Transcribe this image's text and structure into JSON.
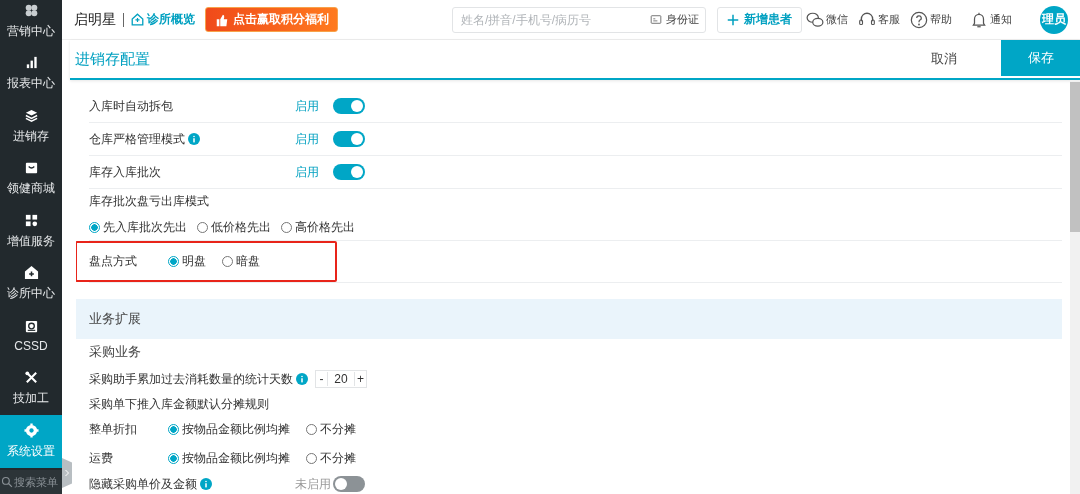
{
  "sidebar": {
    "items": [
      {
        "label": "营销中心",
        "selected": false
      },
      {
        "label": "报表中心",
        "selected": false
      },
      {
        "label": "进销存",
        "selected": false
      },
      {
        "label": "领健商城",
        "selected": false
      },
      {
        "label": "增值服务",
        "selected": false
      },
      {
        "label": "诊所中心",
        "selected": false
      },
      {
        "label": "CSSD",
        "selected": false
      },
      {
        "label": "技加工",
        "selected": false
      },
      {
        "label": "系统设置",
        "selected": true
      }
    ],
    "search_placeholder": "搜索菜单"
  },
  "topbar": {
    "brand": "启明星",
    "overview_link": "诊所概览",
    "promo_banner": "点击赢取积分福利",
    "search_placeholder": "姓名/拼音/手机号/病历号",
    "id_card_button": "身份证",
    "new_patient_button": "新增患者",
    "actions": [
      {
        "label": "微信"
      },
      {
        "label": "客服"
      },
      {
        "label": "帮助"
      },
      {
        "label": "通知"
      }
    ],
    "avatar": "理员"
  },
  "header": {
    "title": "进销存配置",
    "cancel_button": "取消",
    "save_button": "保存"
  },
  "settings": [
    {
      "kind": "toggle",
      "label": "入库时自动拆包",
      "status": "启用",
      "on": true
    },
    {
      "kind": "toggle",
      "label": "仓库严格管理模式",
      "info": true,
      "status": "启用",
      "on": true
    },
    {
      "kind": "toggle",
      "label": "库存入库批次",
      "status": "启用",
      "on": true
    },
    {
      "kind": "radio_stacked",
      "label": "库存批次盘亏出库模式",
      "options": [
        {
          "label": "先入库批次先出",
          "selected": true
        },
        {
          "label": "低价格先出",
          "selected": false
        },
        {
          "label": "高价格先出",
          "selected": false
        }
      ]
    },
    {
      "kind": "radio_inline",
      "label": "盘点方式",
      "highlighted": true,
      "options": [
        {
          "label": "明盘",
          "selected": true
        },
        {
          "label": "暗盘",
          "selected": false
        }
      ]
    },
    {
      "kind": "section",
      "label": "业务扩展"
    },
    {
      "kind": "subheading",
      "label": "采购业务"
    },
    {
      "kind": "stepper",
      "label": "采购助手累加过去消耗数量的统计天数",
      "info": true,
      "minus": "-",
      "value": "20",
      "plus": "+"
    },
    {
      "kind": "text",
      "label": "采购单下推入库金额默认分摊规则"
    },
    {
      "kind": "radio_inline",
      "label": "整单折扣",
      "options": [
        {
          "label": "按物品金额比例均摊",
          "selected": true
        },
        {
          "label": "不分摊",
          "selected": false
        }
      ]
    },
    {
      "kind": "radio_inline",
      "label": "运费",
      "options": [
        {
          "label": "按物品金额比例均摊",
          "selected": true
        },
        {
          "label": "不分摊",
          "selected": false
        }
      ]
    },
    {
      "kind": "toggle",
      "label": "隐藏采购单价及金额",
      "info": true,
      "status": "未启用",
      "on": false
    }
  ]
}
